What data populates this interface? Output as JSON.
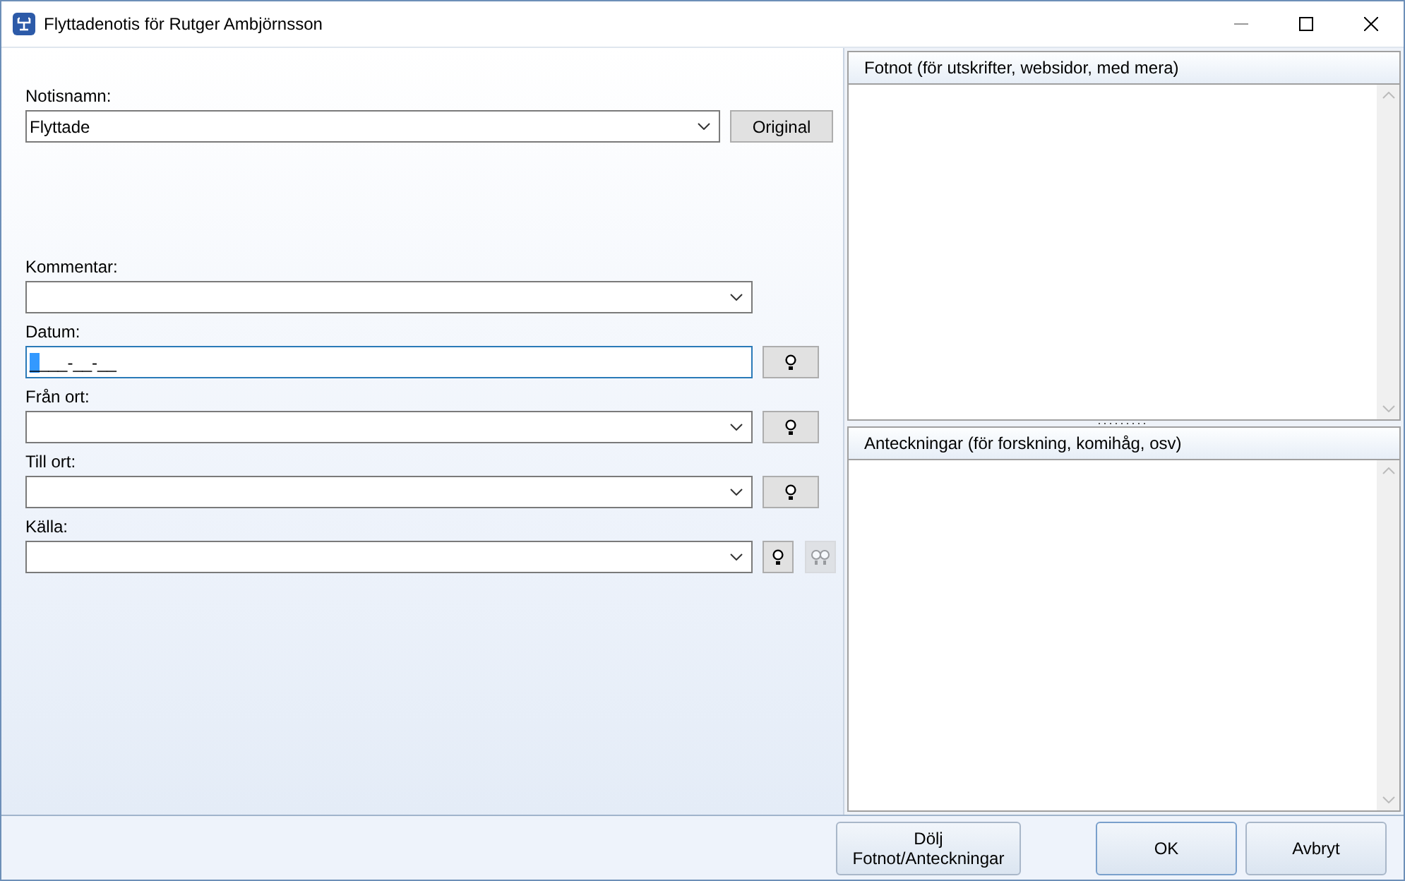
{
  "window": {
    "title": "Flyttadenotis för Rutger Ambjörnsson"
  },
  "fields": [
    {
      "label": "Notisnamn:",
      "kind": "combo",
      "value": "Flyttade",
      "button": "Original",
      "focused": false
    },
    {
      "label": "Kommentar:",
      "kind": "combo",
      "focused": false
    },
    {
      "label": "Datum:",
      "kind": "text",
      "value": "____-__-__",
      "focused": true,
      "lookup": true
    },
    {
      "label": "Från ort:",
      "kind": "combo",
      "focused": false,
      "lookup": true
    },
    {
      "label": "Till ort:",
      "kind": "combo",
      "focused": false,
      "lookup": true
    },
    {
      "label": "Källa:",
      "kind": "combo",
      "focused": false,
      "lookup": true,
      "citation_disabled": true
    }
  ],
  "notes": [
    {
      "title": "Fotnot (för utskrifter, websidor, med mera)"
    },
    {
      "title": "Anteckningar (för forskning, komihåg, osv)"
    }
  ],
  "buttons": [
    {
      "label": "Dölj Fotnot/Anteckningar",
      "kind": "toggle"
    },
    {
      "label": "OK",
      "kind": "default"
    },
    {
      "label": "Avbryt",
      "kind": "cancel"
    }
  ]
}
